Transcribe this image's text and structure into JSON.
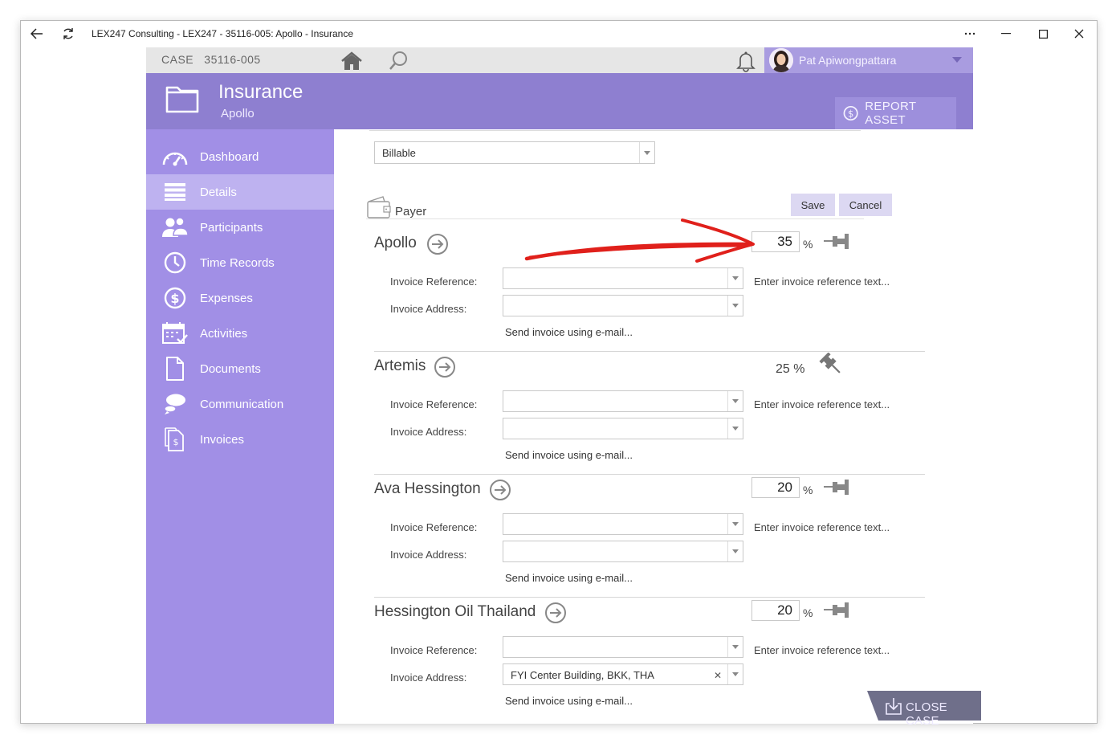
{
  "window": {
    "title": "LEX247 Consulting - LEX247 - 35116-005: Apollo - Insurance",
    "controls": [
      "more-icon",
      "minimize-icon",
      "maximize-icon",
      "close-icon"
    ]
  },
  "topbar": {
    "case_label": "CASE   35116-005",
    "user_name": "Pat Apiwongpattara"
  },
  "header": {
    "title": "Insurance",
    "subtitle": "Apollo",
    "report_asset_label": "REPORT ASSET"
  },
  "sidebar": {
    "items": [
      {
        "label": "Dashboard",
        "icon": "dashboard-icon",
        "active": false
      },
      {
        "label": "Details",
        "icon": "list-icon",
        "active": true
      },
      {
        "label": "Participants",
        "icon": "participants-icon",
        "active": false
      },
      {
        "label": "Time Records",
        "icon": "clock-icon",
        "active": false
      },
      {
        "label": "Expenses",
        "icon": "dollar-icon",
        "active": false
      },
      {
        "label": "Activities",
        "icon": "calendar-icon",
        "active": false
      },
      {
        "label": "Documents",
        "icon": "document-icon",
        "active": false
      },
      {
        "label": "Communication",
        "icon": "chat-icon",
        "active": false
      },
      {
        "label": "Invoices",
        "icon": "invoice-icon",
        "active": false
      }
    ]
  },
  "content": {
    "billing_type": "Billable",
    "payer_label": "Payer",
    "save_label": "Save",
    "cancel_label": "Cancel",
    "invoice_reference_label": "Invoice Reference:",
    "invoice_address_label": "Invoice Address:",
    "reference_hint": "Enter invoice reference text...",
    "email_link": "Send invoice using e-mail...",
    "percent_symbol": "%",
    "payers": [
      {
        "name": "Apollo",
        "percent": "35",
        "percent_editable": true,
        "pinned": false,
        "address": ""
      },
      {
        "name": "Artemis",
        "percent": "25 %",
        "percent_editable": false,
        "pinned": true,
        "address": ""
      },
      {
        "name": "Ava Hessington",
        "percent": "20",
        "percent_editable": true,
        "pinned": false,
        "address": ""
      },
      {
        "name": "Hessington Oil Thailand",
        "percent": "20",
        "percent_editable": true,
        "pinned": false,
        "address": "FYI Center Building, BKK, THA"
      }
    ]
  },
  "close_case_label": "CLOSE CASE",
  "colors": {
    "accent": "#8e7fd0",
    "sidebar": "#a18fe6",
    "sidebar_active": "#beb2f0",
    "annotation": "#e0201b"
  }
}
